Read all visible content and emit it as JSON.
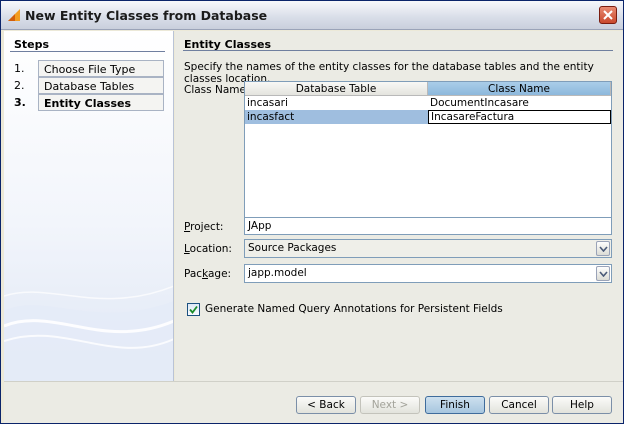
{
  "window": {
    "title": "New Entity Classes from Database",
    "icons": {
      "app": "wizard-icon",
      "close": "close-icon"
    }
  },
  "steps": {
    "title": "Steps",
    "items": [
      {
        "number": "1.",
        "label": "Choose File Type",
        "current": false
      },
      {
        "number": "2.",
        "label": "Database Tables",
        "current": false
      },
      {
        "number": "3.",
        "label": "Entity Classes",
        "current": true
      }
    ]
  },
  "panel": {
    "title": "Entity Classes",
    "description": "Specify the names of the entity classes for the database tables and the entity classes location.",
    "class_names_label": "Class Names:",
    "table": {
      "columns": [
        "Database Table",
        "Class Name"
      ],
      "rows": [
        {
          "table": "incasari",
          "class": "DocumentIncasare",
          "selected": false
        },
        {
          "table": "incasfact",
          "class": "IncasareFactura",
          "selected": true
        }
      ]
    },
    "project": {
      "label": "Project:",
      "value": "JApp"
    },
    "location": {
      "label": "Location:",
      "value": "Source Packages"
    },
    "package": {
      "label": "Package:",
      "value": "japp.model"
    },
    "named_query": {
      "label": "Generate Named Query Annotations for Persistent Fields",
      "checked": true
    }
  },
  "buttons": {
    "back": "< Back",
    "next": "Next >",
    "finish": "Finish",
    "cancel": "Cancel",
    "help": "Help"
  },
  "colors": {
    "selection": "#9fbedf",
    "header_selected": "#8db8dc",
    "default_button": "#a7c6df"
  }
}
